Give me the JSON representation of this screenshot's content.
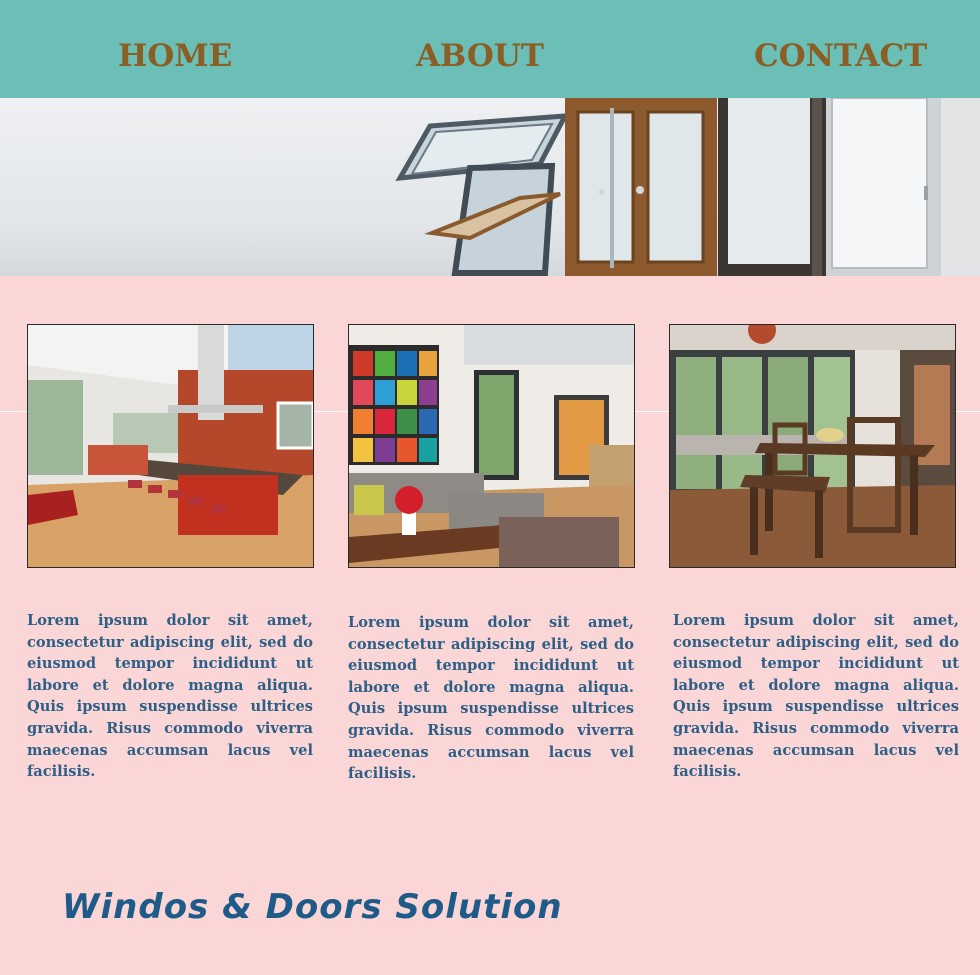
{
  "nav": {
    "items": [
      {
        "label": "HOME"
      },
      {
        "label": "ABOUT"
      },
      {
        "label": "CONTACT"
      }
    ]
  },
  "cards": [
    {
      "text": "Lorem ipsum dolor sit amet, consectetur adipiscing elit, sed do eiusmod tempor incididunt ut labore et dolore magna aliqua. Quis ipsum suspendisse ultrices gravida. Risus commodo viverra maecenas accumsan lacus vel facilisis."
    },
    {
      "text": "Lorem ipsum dolor sit amet, consectetur adipiscing elit, sed do eiusmod tempor incididunt ut labore et dolore magna aliqua. Quis ipsum suspendisse ultrices gravida. Risus commodo viverra maecenas accumsan lacus vel facilisis."
    },
    {
      "text": "Lorem ipsum dolor sit amet, consectetur adipiscing elit, sed do eiusmod tempor incididunt ut labore et dolore magna aliqua. Quis ipsum suspendisse ultrices gravida. Risus commodo viverra maecenas accumsan lacus vel facilisis."
    }
  ],
  "footer": {
    "title": "Windos & Doors Solution"
  },
  "colors": {
    "nav_bg": "#6bbfb6",
    "nav_text": "#8a5e24",
    "page_bg": "#fad6d6",
    "body_text": "#2e5f86",
    "footer_text": "#1f5b88"
  }
}
